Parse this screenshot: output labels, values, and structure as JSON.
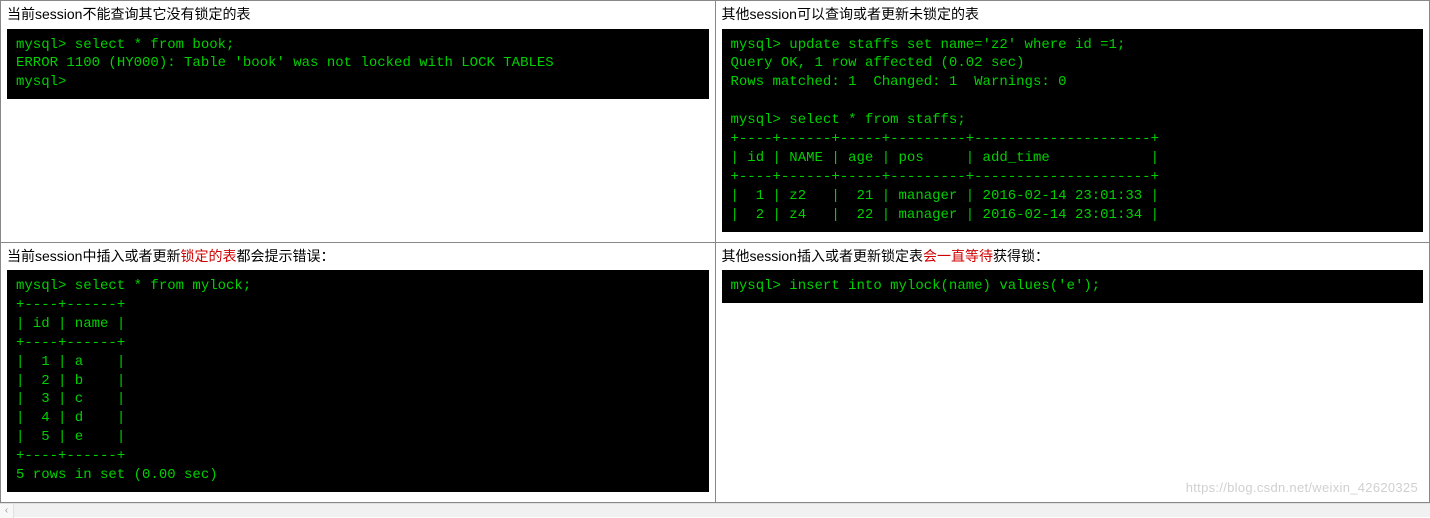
{
  "cells": {
    "r1c1": {
      "caption": "当前session不能查询其它没有锁定的表",
      "term": "mysql> select * from book;\nERROR 1100 (HY000): Table 'book' was not locked with LOCK TABLES\nmysql>"
    },
    "r1c2": {
      "caption": "其他session可以查询或者更新未锁定的表",
      "term": "mysql> update staffs set name='z2' where id =1;\nQuery OK, 1 row affected (0.02 sec)\nRows matched: 1  Changed: 1  Warnings: 0\n\nmysql> select * from staffs;\n+----+------+-----+---------+---------------------+\n| id | NAME | age | pos     | add_time            |\n+----+------+-----+---------+---------------------+\n|  1 | z2   |  21 | manager | 2016-02-14 23:01:33 |\n|  2 | z4   |  22 | manager | 2016-02-14 23:01:34 |"
    },
    "r2c1": {
      "caption_parts": [
        "当前session中插入或者更新",
        "锁定的表",
        "都会提示错误："
      ],
      "term": "mysql> select * from mylock;\n+----+------+\n| id | name |\n+----+------+\n|  1 | a    |\n|  2 | b    |\n|  3 | c    |\n|  4 | d    |\n|  5 | e    |\n+----+------+\n5 rows in set (0.00 sec)"
    },
    "r2c2": {
      "caption_parts": [
        "其他session插入或者更新锁定表",
        "会一直等待",
        "获得锁："
      ],
      "term": "mysql> insert into mylock(name) values('e');"
    }
  },
  "watermark": "https://blog.csdn.net/weixin_42620325",
  "scrollbar_glyph": "‹"
}
